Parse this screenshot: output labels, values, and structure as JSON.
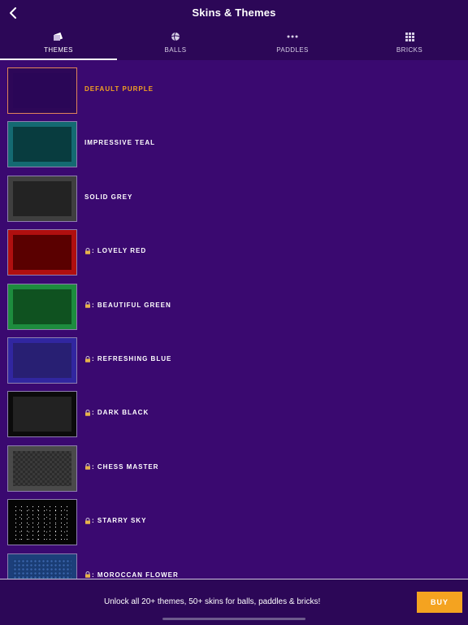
{
  "header": {
    "title": "Skins & Themes",
    "back_icon": "chevron-left-icon"
  },
  "tabs": [
    {
      "label": "THEMES",
      "icon": "themes-icon",
      "active": true
    },
    {
      "label": "BALLS",
      "icon": "ball-icon",
      "active": false
    },
    {
      "label": "PADDLES",
      "icon": "paddle-icon",
      "active": false
    },
    {
      "label": "BRICKS",
      "icon": "bricks-grid-icon",
      "active": false
    }
  ],
  "themes": [
    {
      "label": "DEFAULT PURPLE",
      "locked": false,
      "selected": true,
      "outer": "#2d0758",
      "inner": "#2a0657",
      "border": "#e0835a",
      "pattern": "plain"
    },
    {
      "label": "IMPRESSIVE TEAL",
      "locked": false,
      "selected": false,
      "outer": "#146a72",
      "inner": "#083c3f",
      "border": "#8f7fb0",
      "pattern": "plain"
    },
    {
      "label": "SOLID GREY",
      "locked": false,
      "selected": false,
      "outer": "#3f3f3f",
      "inner": "#232323",
      "border": "#8f7fb0",
      "pattern": "plain"
    },
    {
      "label": ": LOVELY RED",
      "locked": true,
      "selected": false,
      "outer": "#b00f0f",
      "inner": "#5a0000",
      "border": "#8f7fb0",
      "pattern": "plain"
    },
    {
      "label": ": BEAUTIFUL GREEN",
      "locked": true,
      "selected": false,
      "outer": "#1d8c3e",
      "inner": "#0f5220",
      "border": "#8f7fb0",
      "pattern": "plain"
    },
    {
      "label": ": REFRESHING BLUE",
      "locked": true,
      "selected": false,
      "outer": "#3126a0",
      "inner": "#281f73",
      "border": "#8f7fb0",
      "pattern": "plain"
    },
    {
      "label": ": DARK BLACK",
      "locked": true,
      "selected": false,
      "outer": "#0b0b0b",
      "inner": "#222222",
      "border": "#8f7fb0",
      "pattern": "plain"
    },
    {
      "label": ": CHESS MASTER",
      "locked": true,
      "selected": false,
      "outer": "#4a4a4a",
      "inner": "#2c2c2c",
      "border": "#8f7fb0",
      "pattern": "checker"
    },
    {
      "label": ": STARRY SKY",
      "locked": true,
      "selected": false,
      "outer": "#050505",
      "inner": "#050505",
      "border": "#8f7fb0",
      "pattern": "stars"
    },
    {
      "label": ": MOROCCAN FLOWER",
      "locked": true,
      "selected": false,
      "outer": "#1c3f7a",
      "inner": "#1a3d75",
      "border": "#8f7fb0",
      "pattern": "dots"
    }
  ],
  "footer": {
    "promo": "Unlock all 20+ themes, 50+ skins for balls, paddles & bricks!",
    "buy_label": "BUY"
  },
  "colors": {
    "background": "#3a0970",
    "header": "#2c0757",
    "selected_label": "#f4a320",
    "buy_button": "#f4a320",
    "lock": "#e6b34a"
  }
}
